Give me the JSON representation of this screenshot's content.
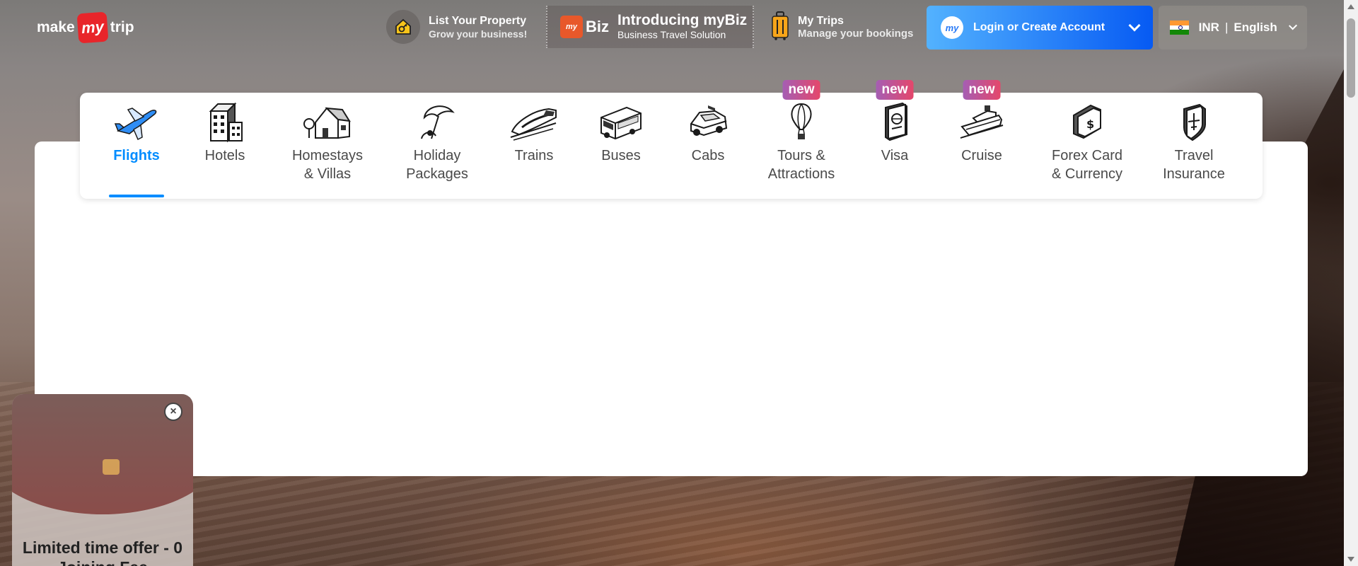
{
  "header": {
    "logo": {
      "make": "make",
      "my": "my",
      "trip": "trip"
    },
    "list_property": {
      "title": "List Your Property",
      "subtitle": "Grow your business!"
    },
    "mybiz": {
      "brand_my": "my",
      "brand_biz": "Biz",
      "title": "Introducing myBiz",
      "subtitle": "Business Travel Solution"
    },
    "my_trips": {
      "title": "My Trips",
      "subtitle": "Manage your bookings"
    },
    "login": {
      "avatar": "my",
      "label": "Login or Create Account"
    },
    "locale": {
      "currency": "INR",
      "separator": "|",
      "language": "English"
    }
  },
  "nav": {
    "items": [
      {
        "label": "Flights",
        "icon": "flight-icon",
        "badge": ""
      },
      {
        "label": "Hotels",
        "icon": "hotel-icon",
        "badge": ""
      },
      {
        "label": "Homestays\n& Villas",
        "icon": "homestay-icon",
        "badge": ""
      },
      {
        "label": "Holiday\nPackages",
        "icon": "holiday-icon",
        "badge": ""
      },
      {
        "label": "Trains",
        "icon": "train-icon",
        "badge": ""
      },
      {
        "label": "Buses",
        "icon": "bus-icon",
        "badge": ""
      },
      {
        "label": "Cabs",
        "icon": "cab-icon",
        "badge": ""
      },
      {
        "label": "Tours &\nAttractions",
        "icon": "balloon-icon",
        "badge": "new"
      },
      {
        "label": "Visa",
        "icon": "passport-icon",
        "badge": "new"
      },
      {
        "label": "Cruise",
        "icon": "cruise-icon",
        "badge": "new"
      },
      {
        "label": "Forex Card\n& Currency",
        "icon": "forex-card-icon",
        "badge": ""
      },
      {
        "label": "Travel\nInsurance",
        "icon": "insurance-shield-icon",
        "badge": ""
      }
    ],
    "active": "Flights"
  },
  "offer": {
    "close": "×",
    "text_line1": "Limited time offer - 0",
    "text_line2": "Joining Fee"
  },
  "colors": {
    "accent": "#008cff",
    "login_gradient_start": "#53b2fe",
    "login_gradient_end": "#065af3",
    "badge_start": "#a55eb4",
    "badge_end": "#e5476b",
    "brand_red": "#e8252a"
  }
}
